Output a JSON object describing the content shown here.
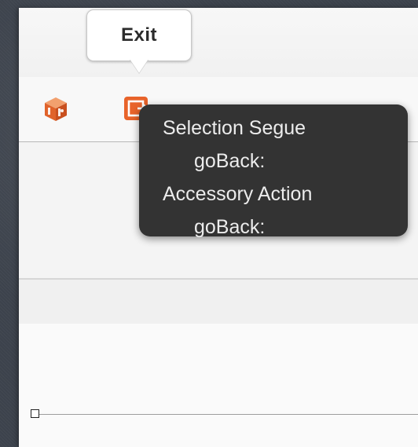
{
  "exit_callout": {
    "label": "Exit"
  },
  "object_bar": {
    "icons": [
      {
        "name": "view-controller-cube-icon",
        "color": "#e0632b"
      },
      {
        "name": "exit-icon",
        "color": "#e8632a"
      }
    ]
  },
  "tooltip": {
    "lines": [
      "Selection Segue",
      "goBack:",
      "Accessory Action",
      "goBack:"
    ]
  },
  "colors": {
    "accent_orange": "#e8632a",
    "tooltip_bg": "#333333",
    "tooltip_text": "#ececec"
  }
}
